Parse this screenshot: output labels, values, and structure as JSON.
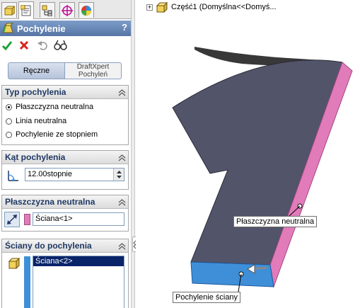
{
  "panel": {
    "title": "Pochylenie",
    "help": "?",
    "mode_manual": "Ręczne",
    "mode_draftxpert_line1": "DraftXpert",
    "mode_draftxpert_line2": "Pochyleń"
  },
  "draft_type": {
    "header": "Typ pochylenia",
    "options": [
      "Płaszczyzna neutralna",
      "Linia neutralna",
      "Pochylenie ze stopniem"
    ],
    "selected": "Płaszczyzna neutralna"
  },
  "draft_angle": {
    "header": "Kąt pochylenia",
    "value": "12.00stopnie"
  },
  "neutral_plane": {
    "header": "Płaszczyzna neutralna",
    "value": "Ściana<1>"
  },
  "faces": {
    "header": "Ściany do pochylenia",
    "items": [
      "Ściana<2>"
    ]
  },
  "tree": {
    "label": "Część1  (Domyślna<<Domyś..."
  },
  "callouts": {
    "neutral_plane": "Płaszczyzna neutralna",
    "draft_face": "Pochylenie ściany"
  },
  "colors": {
    "title_bar": "#5f7fb1",
    "neutral_face": "#e27bb9",
    "draft_face": "#3f8fd8",
    "model_top": "#52546a"
  },
  "icons": [
    "feature-manager-icon",
    "property-manager-icon",
    "configuration-manager-icon",
    "dimxpert-icon",
    "display-manager-icon",
    "draft-feature-icon",
    "ok-check-icon",
    "cancel-x-icon",
    "undo-icon",
    "detailed-preview-icon",
    "neutral-plane-icon",
    "faces-icon",
    "angle-icon",
    "part-icon"
  ]
}
